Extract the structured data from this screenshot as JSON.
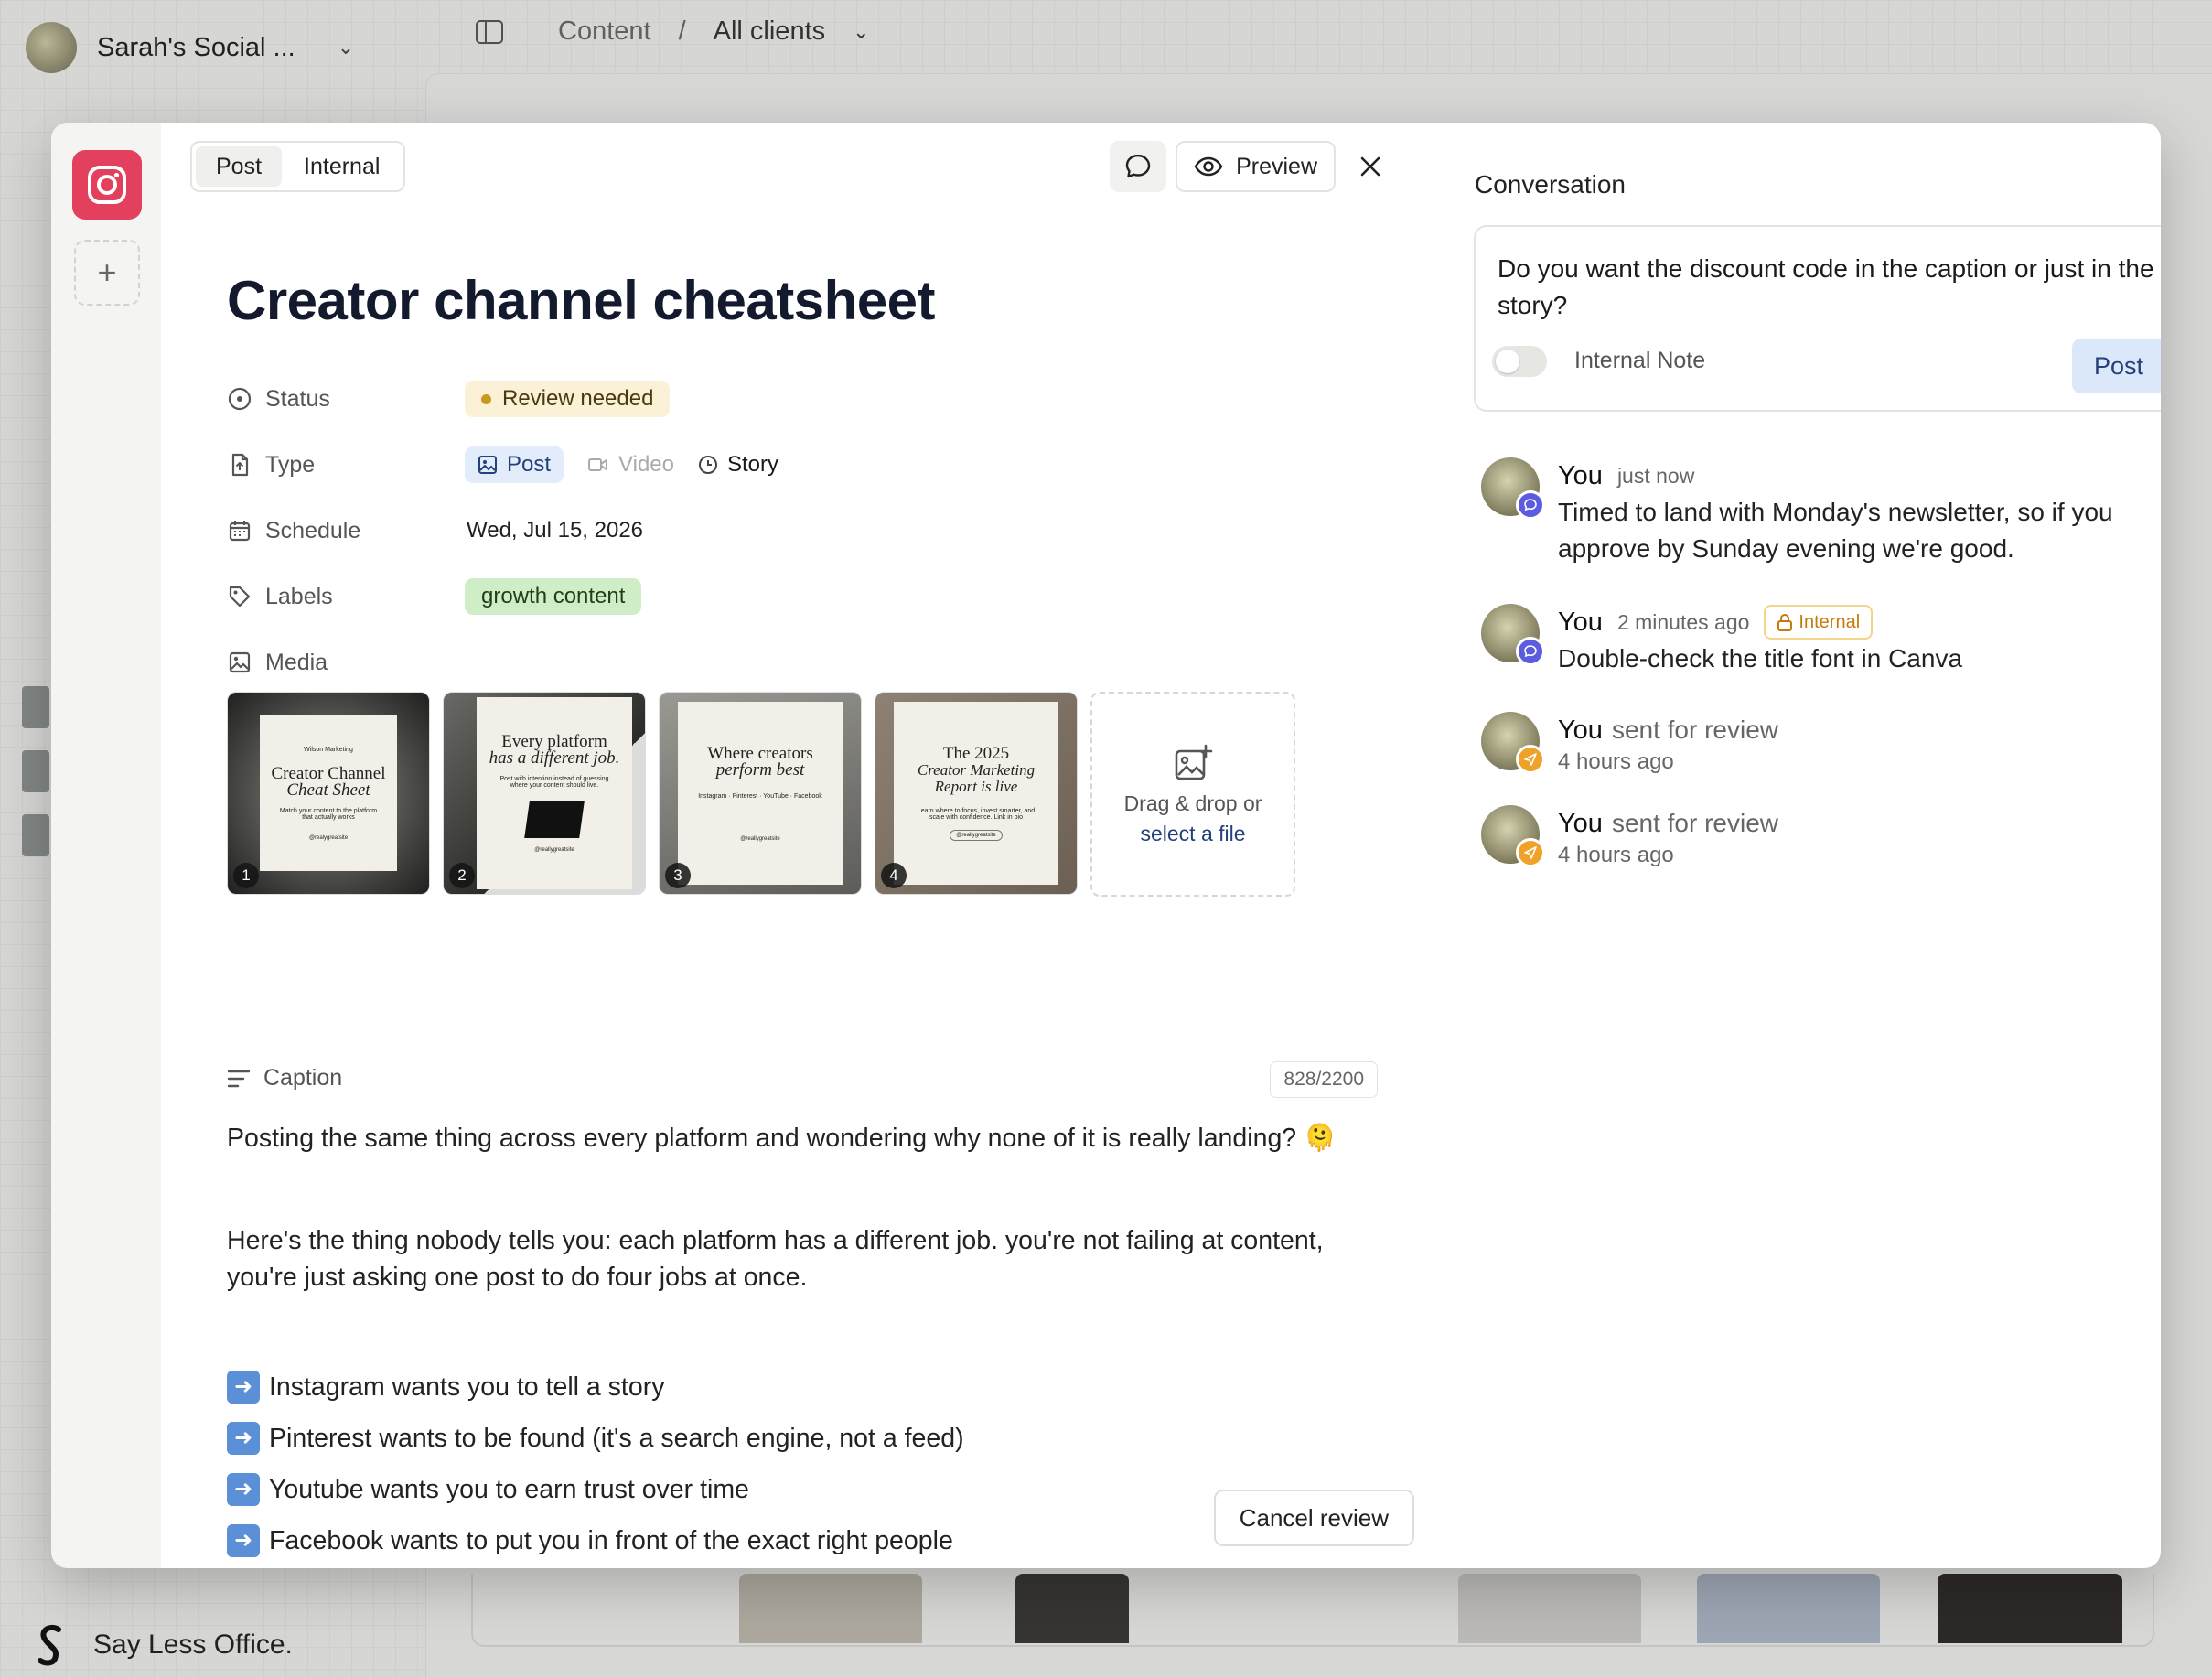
{
  "app": {
    "workspace_name": "Sarah's Social ...",
    "breadcrumb": [
      "Content",
      "All clients"
    ],
    "footer_brand": "Say Less Office."
  },
  "modal": {
    "tabs": [
      "Post",
      "Internal"
    ],
    "active_tab": "Post",
    "preview_label": "Preview",
    "title": "Creator channel cheatsheet",
    "props": {
      "status_label": "Status",
      "status_value": "Review needed",
      "type_label": "Type",
      "type_options": [
        "Post",
        "Video",
        "Story"
      ],
      "type_selected": "Post",
      "schedule_label": "Schedule",
      "schedule_value": "Wed, Jul 15, 2026",
      "labels_label": "Labels",
      "labels_value": "growth content",
      "media_label": "Media"
    },
    "media": [
      {
        "index": "1",
        "line1": "Creator Channel",
        "line2": "Cheat Sheet",
        "small": "Match your content to the platform that actually works",
        "top": "Wilson Marketing",
        "handle": "@realygreatsite"
      },
      {
        "index": "2",
        "line1": "Every platform",
        "line2": "has a different job.",
        "small": "Post with intention instead of guessing where your content should live.",
        "handle": "@reallygreatsite"
      },
      {
        "index": "3",
        "line1": "Where creators",
        "line2": "perform best",
        "small": "Instagram · Pinterest · YouTube · Facebook",
        "handle": "@reallygreatsite"
      },
      {
        "index": "4",
        "line1": "The 2025",
        "line2": "Creator Marketing Report is live",
        "small": "Learn where to focus, invest smarter, and scale with confidence. Link in bio",
        "handle": "@reallygreatsite"
      }
    ],
    "dropzone": {
      "text": "Drag & drop or",
      "link": "select a file"
    },
    "caption_label": "Caption",
    "caption_count": "828/2200",
    "caption": {
      "p1": "Posting the same thing across every platform and wondering why none of it is really landing? 🫠",
      "p2": "Here's the thing nobody tells you: each platform has a different job. you're not failing at content, you're just asking one post to do four jobs at once.",
      "bullets": [
        "Instagram wants you to tell a story",
        "Pinterest wants to be found (it's a search engine, not a feed)",
        "Youtube wants you to earn trust over time",
        "Facebook wants to put you in front of the exact right people"
      ]
    },
    "cancel_label": "Cancel review"
  },
  "conversation": {
    "title": "Conversation",
    "draft": "Do you want the discount code in the caption or just in the story?",
    "internal_note_label": "Internal Note",
    "post_label": "Post",
    "messages": [
      {
        "author": "You",
        "time": "just now",
        "text": "Timed to land with Monday's newsletter, so if you approve by Sunday evening we're good."
      },
      {
        "author": "You",
        "time": "2 minutes ago",
        "badge": "Internal",
        "text": "Double-check the title font in Canva"
      },
      {
        "author": "You",
        "action": "sent for review",
        "time": "4 hours ago"
      },
      {
        "author": "You",
        "action": "sent for review",
        "time": "4 hours ago"
      }
    ]
  },
  "colors": {
    "instagram": "#e2405c",
    "status_bg": "#fbf1d6",
    "label_bg": "#cfeec8",
    "post_button_bg": "#dbe8fa",
    "internal_badge": "#c47a0c"
  }
}
